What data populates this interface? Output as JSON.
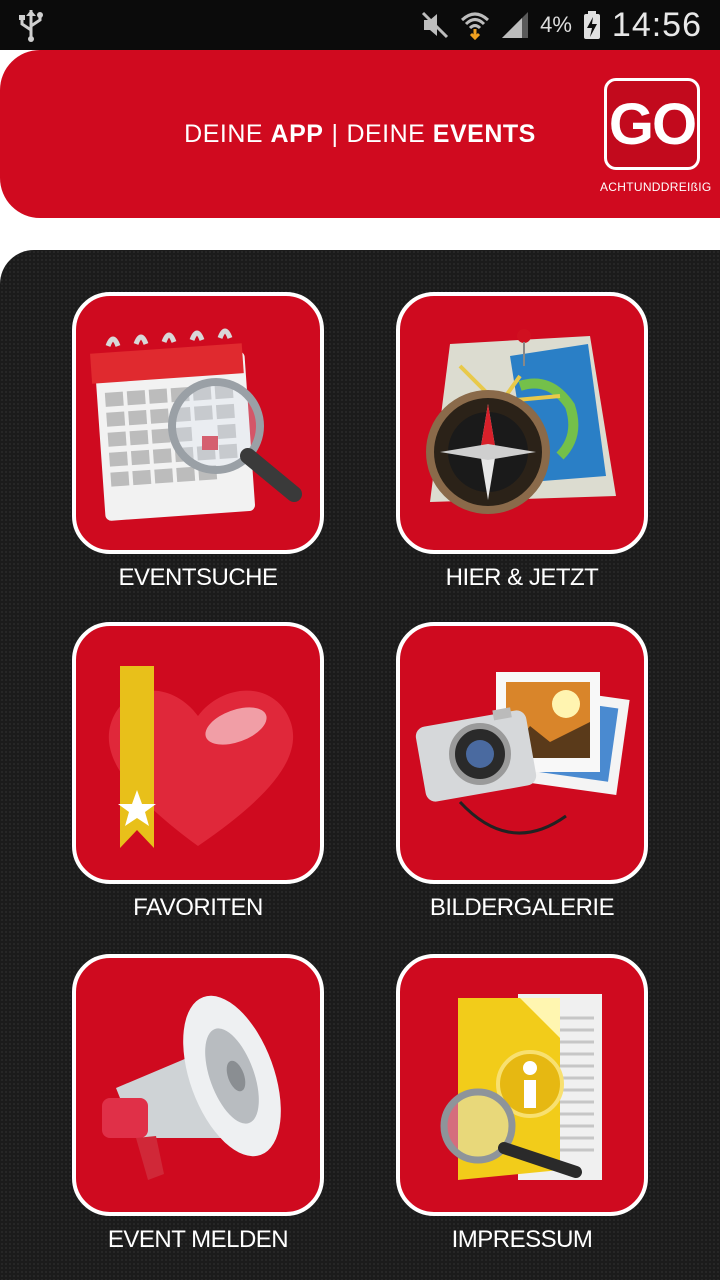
{
  "status_bar": {
    "battery_percent": "4%",
    "time": "14:56"
  },
  "header": {
    "tagline_part1": "DEINE ",
    "tagline_bold1": "APP",
    "tagline_sep": "|",
    "tagline_part2": "DEINE ",
    "tagline_bold2": "EVENTS",
    "logo_text": "GO",
    "logo_subtext": "ACHTUNDDREIßIG"
  },
  "tiles": [
    {
      "label": "EVENTSUCHE",
      "icon": "calendar-search-icon"
    },
    {
      "label": "HIER & JETZT",
      "icon": "map-compass-icon"
    },
    {
      "label": "FAVORITEN",
      "icon": "heart-bookmark-icon"
    },
    {
      "label": "BILDERGALERIE",
      "icon": "camera-photos-icon"
    },
    {
      "label": "EVENT MELDEN",
      "icon": "megaphone-icon"
    },
    {
      "label": "IMPRESSUM",
      "icon": "info-document-icon"
    }
  ],
  "colors": {
    "brand_red": "#d00a1f",
    "background_dark": "#1b1b1b",
    "status_bar": "#0b0b0b"
  }
}
